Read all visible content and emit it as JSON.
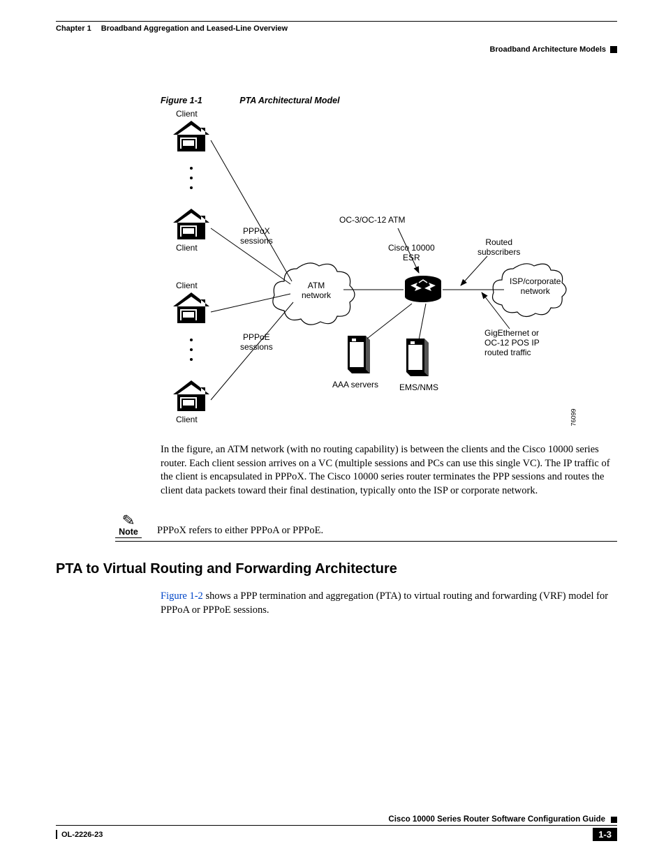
{
  "header": {
    "chapter": "Chapter 1",
    "chapter_title": "Broadband Aggregation and Leased-Line Overview",
    "section": "Broadband Architecture Models"
  },
  "figure": {
    "label": "Figure 1-1",
    "title": "PTA Architectural Model",
    "labels": {
      "client_top": "Client",
      "client_mid": "Client",
      "client_low": "Client",
      "client_bot": "Client",
      "pppox": "PPPoX\nsessions",
      "pppoe": "PPPoE\nsessions",
      "atm_net": "ATM\nnetwork",
      "oc3": "OC-3/OC-12 ATM",
      "cisco": "Cisco 10000\nESR",
      "routed": "Routed\nsubscribers",
      "isp": "ISP/corporate\nnetwork",
      "gig": "GigEthernet or\nOC-12 POS IP\nrouted traffic",
      "aaa": "AAA servers",
      "ems": "EMS/NMS",
      "fig_id": "76099"
    }
  },
  "para1": "In the figure, an ATM network (with no routing capability) is between the clients and the Cisco 10000 series router. Each client session arrives on a VC (multiple sessions and PCs can use this single VC). The IP traffic of the client is encapsulated in PPPoX. The Cisco 10000 series router terminates the PPP sessions and routes the client data packets toward their final destination, typically onto the ISP or corporate network.",
  "note": {
    "label": "Note",
    "text": "PPPoX refers to either PPPoA or PPPoE."
  },
  "h2": "PTA to Virtual Routing and Forwarding Architecture",
  "para2_link": "Figure 1-2",
  "para2_rest": " shows a PPP termination and aggregation (PTA) to virtual routing and forwarding (VRF) model for PPPoA or PPPoE sessions.",
  "footer": {
    "guide": "Cisco 10000 Series Router Software Configuration Guide",
    "doc_id": "OL-2226-23",
    "page": "1-3"
  }
}
